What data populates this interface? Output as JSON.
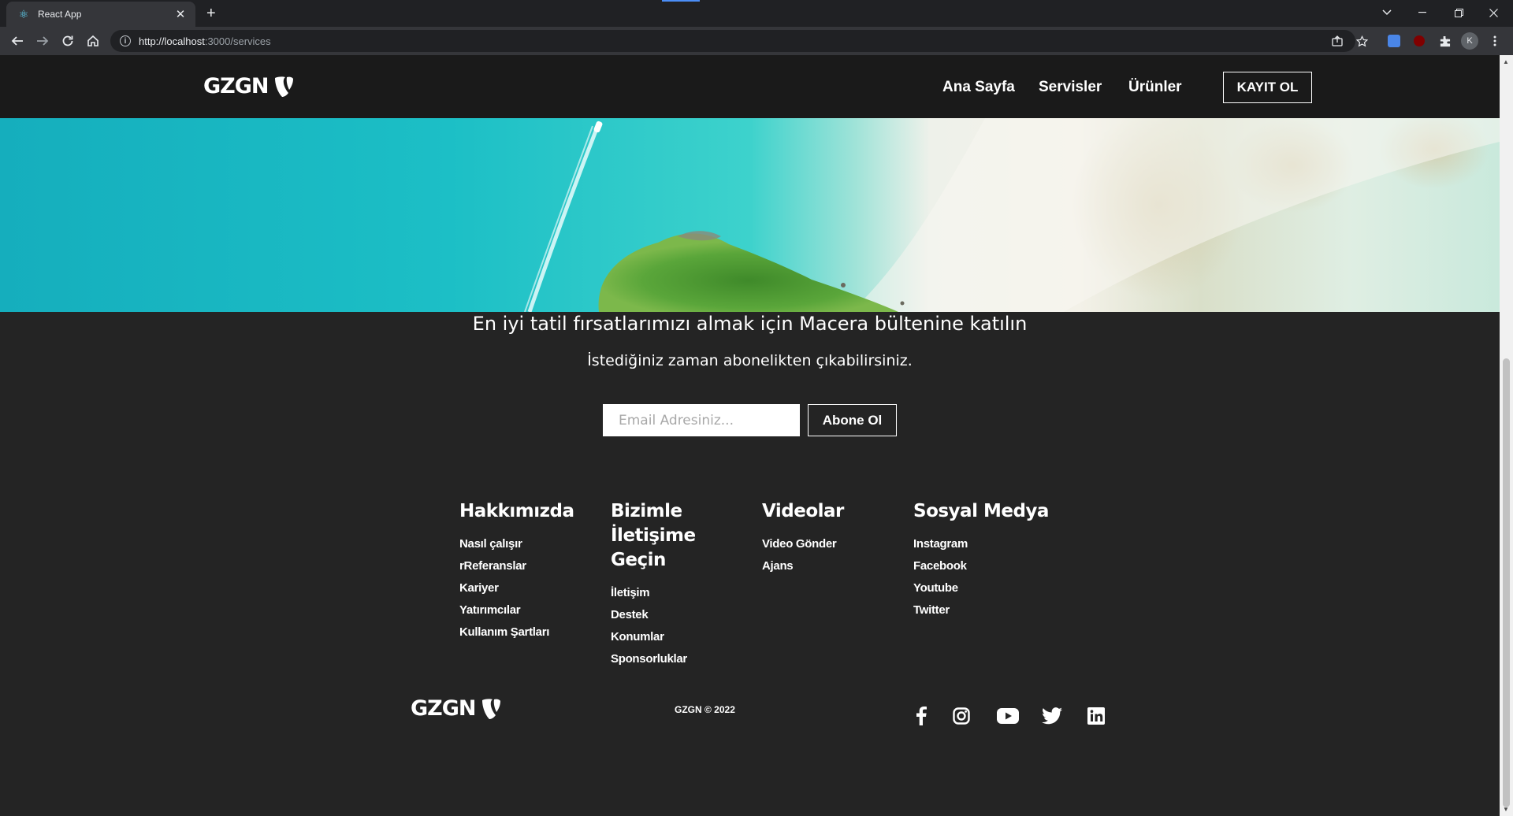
{
  "browser": {
    "tab_title": "React App",
    "tab_close": "✕",
    "new_tab": "+",
    "url_host": "http://localhost",
    "url_path": ":3000/services",
    "profile_initial": "K"
  },
  "nav": {
    "logo_text": "GZGN",
    "links": [
      "Ana Sayfa",
      "Servisler",
      "Ürünler"
    ],
    "signup_label": "KAYIT OL"
  },
  "newsletter": {
    "title": "En iyi tatil fırsatlarımızı almak için Macera bültenine katılın",
    "subtitle": "İstediğiniz zaman abonelikten çıkabilirsiniz.",
    "email_placeholder": "Email Adresiniz...",
    "subscribe_label": "Abone Ol"
  },
  "footer": {
    "columns": [
      {
        "heading": "Hakkımızda",
        "links": [
          "Nasıl çalışır",
          "rReferanslar",
          "Kariyer",
          "Yatırımcılar",
          "Kullanım Şartları"
        ]
      },
      {
        "heading": "Bizimle İletişime Geçin",
        "links": [
          "İletişim",
          "Destek",
          "Konumlar",
          "Sponsorluklar"
        ]
      },
      {
        "heading": "Videolar",
        "links": [
          "Video Gönder",
          "Ajans"
        ]
      },
      {
        "heading": "Sosyal Medya",
        "links": [
          "Instagram",
          "Facebook",
          "Youtube",
          "Twitter"
        ]
      }
    ],
    "logo_text": "GZGN",
    "copyright": "GZGN © 2022",
    "social_icons": [
      "facebook-icon",
      "instagram-icon",
      "youtube-icon",
      "twitter-icon",
      "linkedin-icon"
    ]
  }
}
